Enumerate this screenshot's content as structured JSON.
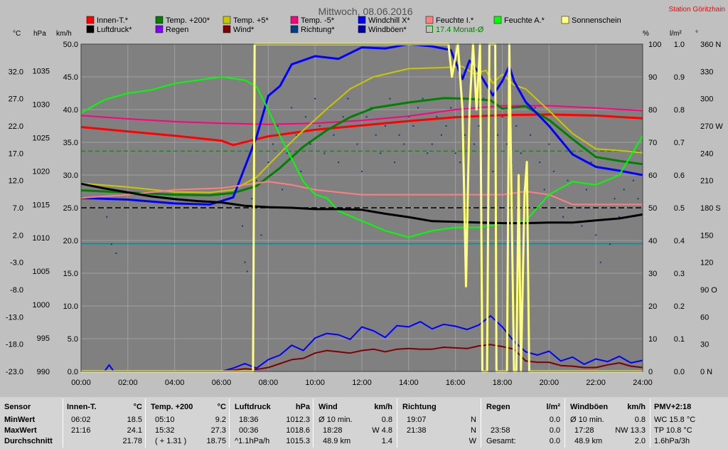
{
  "chart_data": {
    "type": "line",
    "title": "Mittwoch, 08.06.2016",
    "station": "Station Göritzhain",
    "x_ticks": [
      "00:00",
      "02:00",
      "04:00",
      "06:00",
      "08:00",
      "10:00",
      "12:00",
      "14:00",
      "16:00",
      "18:00",
      "20:00",
      "22:00",
      "24:00"
    ],
    "axes": {
      "temp": {
        "unit": "°C",
        "ticks": [
          "32.0",
          "27.0",
          "22.0",
          "17.0",
          "12.0",
          "7.0",
          "2.0",
          "-3.0",
          "-8.0",
          "-13.0",
          "-18.0",
          "-23.0"
        ],
        "range": [
          -23,
          37
        ]
      },
      "pressure": {
        "unit": "hPa",
        "ticks": [
          "1035",
          "1030",
          "1025",
          "1020",
          "1015",
          "1010",
          "1005",
          "1000",
          "995",
          "990"
        ],
        "range": [
          990,
          1039
        ]
      },
      "wind": {
        "unit": "km/h",
        "ticks": [
          "50.0",
          "45.0",
          "40.0",
          "35.0",
          "30.0",
          "25.0",
          "20.0",
          "15.0",
          "10.0",
          "5.0",
          "0.0"
        ],
        "range": [
          0,
          50
        ]
      },
      "humidity": {
        "unit": "%",
        "ticks": [
          "100",
          "90",
          "80",
          "70",
          "60",
          "50",
          "40",
          "30",
          "20",
          "10",
          "0"
        ],
        "range": [
          0,
          100
        ]
      },
      "rain": {
        "unit": "l/m²",
        "ticks": [
          "1.0",
          "0.9",
          "0.8",
          "0.7",
          "0.6",
          "0.5",
          "0.4",
          "0.3",
          "0.2",
          "0.1",
          "0.0"
        ],
        "range": [
          0,
          1
        ]
      },
      "direction": {
        "unit": "°",
        "ticks": [
          "360 N",
          "330",
          "300",
          "270 W",
          "240",
          "210",
          "180 S",
          "150",
          "120",
          "90 O",
          "60",
          "30",
          "0 N"
        ],
        "range": [
          0,
          360
        ]
      }
    },
    "legend": [
      {
        "name": "Innen-T.*",
        "color": "#ff0000"
      },
      {
        "name": "Temp. +200*",
        "color": "#008000"
      },
      {
        "name": "Temp. +5*",
        "color": "#c8c800"
      },
      {
        "name": "Temp. -5*",
        "color": "#ff0080"
      },
      {
        "name": "Windchill X*",
        "color": "#0000ff"
      },
      {
        "name": "Feuchte I.*",
        "color": "#ff8080"
      },
      {
        "name": "Feuchte A.*",
        "color": "#00ff00"
      },
      {
        "name": "Sonnenschein",
        "color": "#ffff80"
      },
      {
        "name": "Luftdruck*",
        "color": "#000000"
      },
      {
        "name": "Regen",
        "color": "#8000ff"
      },
      {
        "name": "Wind*",
        "color": "#800000"
      },
      {
        "name": "Richtung*",
        "color": "#004080"
      },
      {
        "name": "Windböen*",
        "color": "#0000a0"
      },
      {
        "name": "17.4 Monat-Ø",
        "color": "#008000",
        "hollow": true
      }
    ],
    "reference_lines": [
      {
        "axis": "temp",
        "value": 17.4,
        "color": "#008000",
        "style": "dash"
      },
      {
        "axis": "wind",
        "value": 25,
        "color": "#000000",
        "style": "dash"
      },
      {
        "axis": "humidity",
        "value": 39,
        "color": "#008080",
        "style": "solid"
      }
    ],
    "series": [
      {
        "name": "Innen-T.*",
        "axis": "temp",
        "color": "#ff0000",
        "width": 3,
        "x": [
          0,
          2,
          4,
          6,
          6.5,
          8,
          10,
          12,
          14,
          16,
          18,
          20,
          22,
          24
        ],
        "y": [
          21.8,
          21.0,
          20.2,
          19.3,
          18.5,
          20.1,
          21.3,
          22.1,
          22.9,
          23.6,
          24.0,
          24.1,
          23.9,
          23.4
        ]
      },
      {
        "name": "Temp. -5*",
        "axis": "temp",
        "color": "#ff0080",
        "width": 2,
        "x": [
          0,
          2,
          4,
          6,
          8,
          10,
          12,
          14,
          16,
          18,
          20,
          22,
          24
        ],
        "y": [
          23.9,
          23.3,
          22.8,
          22.5,
          22.3,
          22.5,
          23.0,
          23.8,
          25.0,
          25.7,
          25.7,
          25.3,
          24.8
        ]
      },
      {
        "name": "Temp. +5*",
        "axis": "temp",
        "color": "#c8c800",
        "width": 2,
        "x": [
          0,
          2,
          4,
          5.5,
          6.5,
          7.5,
          8.5,
          9.5,
          10.5,
          11.5,
          12.5,
          14,
          15.5,
          16.3,
          16.8,
          17.3,
          17.6,
          18,
          18.5,
          19,
          20,
          21,
          22,
          23,
          24
        ],
        "y": [
          11.5,
          10.8,
          9.9,
          9.8,
          10.3,
          12.6,
          17.0,
          21.2,
          25.1,
          28.8,
          31.0,
          32.5,
          32.7,
          32.9,
          31.5,
          32.2,
          29.8,
          31.5,
          29.5,
          28.8,
          24.8,
          20.6,
          17.8,
          17.5,
          17.1
        ]
      },
      {
        "name": "Temp. +200*",
        "axis": "temp",
        "color": "#008000",
        "width": 3,
        "x": [
          0,
          2,
          4,
          5.5,
          6.5,
          7.5,
          8.5,
          9.5,
          10.5,
          11.5,
          12.5,
          14,
          15.5,
          16.5,
          17.5,
          18,
          19,
          20,
          21,
          22,
          23,
          24
        ],
        "y": [
          10.2,
          9.8,
          9.4,
          9.3,
          9.7,
          11.0,
          14.3,
          18.2,
          21.2,
          23.6,
          25.3,
          26.3,
          27.1,
          27.0,
          26.7,
          25.2,
          25.6,
          23.1,
          19.6,
          16.3,
          15.6,
          15.0
        ]
      },
      {
        "name": "Windchill X*",
        "axis": "temp",
        "color": "#0000ff",
        "width": 3,
        "x": [
          0,
          2,
          4,
          5.5,
          6.5,
          7.5,
          8,
          8.5,
          9,
          10,
          11,
          12,
          13,
          14,
          15,
          15.8,
          16.3,
          16.6,
          17,
          17.6,
          18,
          18.3,
          18.5,
          19,
          20,
          21,
          22,
          23,
          24
        ],
        "y": [
          8.8,
          8.5,
          7.8,
          7.6,
          8.9,
          20.0,
          27.5,
          29.3,
          33.3,
          34.8,
          34.3,
          36.4,
          36.2,
          37.0,
          36.6,
          35.9,
          30.6,
          34.0,
          31.8,
          27.6,
          30.2,
          33.0,
          30.2,
          26.4,
          22.0,
          16.8,
          14.5,
          13.8,
          13.0
        ]
      },
      {
        "name": "Feuchte I.*",
        "axis": "humidity",
        "color": "#ff8080",
        "width": 2,
        "x": [
          0,
          2,
          4,
          6,
          7,
          8,
          9,
          10,
          12,
          14,
          16,
          18,
          19,
          20,
          21,
          22,
          24
        ],
        "y": [
          53,
          54,
          55.5,
          56,
          57,
          58,
          57,
          55.5,
          54,
          54,
          54,
          54,
          55,
          54,
          51,
          51,
          51
        ]
      },
      {
        "name": "Feuchte A.*",
        "axis": "humidity",
        "color": "#00ff00",
        "width": 2,
        "x": [
          0,
          1,
          2,
          3,
          4,
          5,
          6,
          7,
          7.5,
          8,
          8.5,
          9,
          9.5,
          10,
          10.5,
          11,
          12,
          13,
          14,
          15,
          16,
          17,
          18,
          19,
          19.5,
          20,
          21,
          22,
          23,
          24
        ],
        "y": [
          79,
          83,
          85,
          86,
          88,
          89,
          90,
          89,
          87,
          80,
          72,
          65,
          58,
          54,
          53,
          49,
          46,
          43,
          41,
          43,
          44,
          44,
          45,
          46,
          50,
          54,
          58,
          57,
          60,
          72
        ]
      },
      {
        "name": "Luftdruck*",
        "axis": "pressure",
        "color": "#000000",
        "width": 3,
        "x": [
          0,
          1,
          2,
          3,
          4,
          5,
          6,
          7,
          8,
          9,
          10,
          11,
          12,
          13,
          14,
          15,
          16,
          17,
          18,
          19,
          20,
          21,
          22,
          23,
          24
        ],
        "y": [
          1018.1,
          1017.4,
          1016.8,
          1016.2,
          1015.8,
          1015.5,
          1015.3,
          1014.8,
          1014.6,
          1014.5,
          1014.3,
          1014.3,
          1014.2,
          1013.6,
          1013.1,
          1012.5,
          1012.4,
          1012.3,
          1012.2,
          1012.2,
          1012.3,
          1012.3,
          1012.6,
          1012.9,
          1013.5
        ]
      },
      {
        "name": "Windböen*",
        "axis": "wind",
        "color": "#0000ff",
        "width": 2,
        "x": [
          0,
          1,
          1.2,
          1.4,
          2,
          3,
          4,
          5,
          6,
          6.5,
          7,
          7.5,
          8,
          8.5,
          9,
          9.5,
          10,
          10.5,
          11,
          11.5,
          12,
          12.5,
          13,
          13.5,
          14,
          14.5,
          15,
          15.5,
          16,
          16.5,
          17,
          17.5,
          18,
          18.5,
          19,
          19.5,
          20,
          20.5,
          21,
          21.5,
          22,
          22.5,
          23,
          23.5,
          24
        ],
        "y": [
          0,
          0,
          1.0,
          0,
          0,
          0,
          0,
          0,
          0,
          0.5,
          1.2,
          0.5,
          1.8,
          2.5,
          4.0,
          3.2,
          5.1,
          5.8,
          5.6,
          4.9,
          6.8,
          6.2,
          5.2,
          7.0,
          6.8,
          7.6,
          6.5,
          7.2,
          6.9,
          6.4,
          7.1,
          8.5,
          6.8,
          4.6,
          3.0,
          2.5,
          3.1,
          1.6,
          2.2,
          1.1,
          1.9,
          1.5,
          2.3,
          1.3,
          1.7
        ]
      },
      {
        "name": "Wind*",
        "axis": "wind",
        "color": "#800000",
        "width": 2,
        "x": [
          0,
          6,
          6.5,
          7,
          7.5,
          8,
          8.5,
          9,
          9.5,
          10,
          10.5,
          11,
          11.5,
          12,
          12.5,
          13,
          13.5,
          14,
          14.5,
          15,
          15.5,
          16,
          16.5,
          17,
          17.5,
          18,
          18.5,
          19,
          19.5,
          20,
          20.5,
          21,
          21.5,
          22,
          22.5,
          23,
          23.5,
          24
        ],
        "y": [
          0,
          0,
          0.2,
          0.4,
          0.3,
          0.6,
          1.2,
          1.8,
          2.0,
          2.8,
          3.2,
          3.0,
          2.8,
          3.2,
          3.4,
          3.0,
          3.4,
          3.5,
          3.4,
          3.4,
          3.7,
          3.6,
          3.5,
          3.9,
          4.1,
          3.8,
          3.4,
          1.6,
          1.4,
          1.4,
          0.9,
          0.8,
          0.6,
          0.6,
          1.0,
          1.3,
          0.8,
          0.6
        ]
      },
      {
        "name": "Sonnenschein",
        "axis": "wind",
        "color": "#ffff80",
        "width": 3,
        "x": [
          0,
          7.35,
          7.42,
          15.7,
          15.85,
          16.1,
          16.3,
          16.45,
          16.6,
          16.75,
          16.9,
          17.05,
          17.15,
          17.35,
          17.45,
          17.5,
          17.7,
          17.75,
          18.2,
          18.3,
          18.5,
          18.6,
          18.7,
          18.8,
          18.95,
          19.05,
          19.15,
          19.25,
          19.35,
          19.5,
          24
        ],
        "y": [
          0,
          0,
          50,
          50,
          45,
          50,
          40,
          13,
          40,
          50,
          40,
          50,
          0,
          0,
          50,
          50,
          50,
          0,
          0,
          50,
          0,
          0,
          30,
          0,
          27,
          32,
          0,
          0,
          0,
          0,
          0
        ]
      },
      {
        "name": "Regen",
        "axis": "rain",
        "color": "#8000ff",
        "width": 1,
        "x": [
          0,
          24
        ],
        "y": [
          0,
          0
        ]
      }
    ],
    "direction_dots": {
      "axis": "direction",
      "color": "#004080",
      "x": [
        1.1,
        1.3,
        1.5,
        6.9,
        7.0,
        7.1,
        7.3,
        7.5,
        7.7,
        8.0,
        8.2,
        8.4,
        8.6,
        8.8,
        9.0,
        9.2,
        9.4,
        9.6,
        9.8,
        10.0,
        10.2,
        10.4,
        10.6,
        10.8,
        11.0,
        11.2,
        11.4,
        11.6,
        11.8,
        12.0,
        12.2,
        12.4,
        12.6,
        12.8,
        13.0,
        13.2,
        13.4,
        13.6,
        13.8,
        14.0,
        14.2,
        14.4,
        14.6,
        14.8,
        15.0,
        15.2,
        15.4,
        15.6,
        15.8,
        16.0,
        16.2,
        16.4,
        16.6,
        16.8,
        17.0,
        17.2,
        17.4,
        17.6,
        17.8,
        18.0,
        18.2,
        18.4,
        18.6,
        18.8,
        19.0,
        19.2,
        19.4,
        19.6,
        19.8,
        20.0,
        20.2,
        20.4,
        20.6,
        20.8,
        21.0,
        21.2,
        21.4,
        21.6,
        21.8,
        22.0,
        22.2,
        22.4,
        22.6,
        22.8,
        23.0,
        23.2,
        23.4,
        23.6,
        23.8
      ],
      "y": [
        170,
        140,
        130,
        160,
        120,
        110,
        190,
        210,
        150,
        230,
        250,
        270,
        200,
        240,
        290,
        260,
        220,
        280,
        250,
        300,
        270,
        240,
        290,
        260,
        230,
        280,
        300,
        270,
        250,
        220,
        280,
        290,
        260,
        240,
        270,
        300,
        230,
        260,
        250,
        280,
        270,
        290,
        300,
        240,
        250,
        280,
        260,
        270,
        290,
        240,
        230,
        260,
        280,
        250,
        270,
        300,
        240,
        220,
        260,
        280,
        250,
        230,
        270,
        240,
        210,
        260,
        290,
        230,
        200,
        250,
        220,
        190,
        170,
        210,
        240,
        180,
        160,
        200,
        230,
        150,
        120,
        180,
        140,
        190,
        170,
        200,
        180,
        210,
        190
      ]
    }
  },
  "stats": {
    "columns": [
      {
        "id": "sensor",
        "header": "Sensor",
        "unit": "",
        "rows": [
          "MinWert",
          "MaxWert",
          "Durchschnitt"
        ],
        "rowvals": [
          [
            "",
            ""
          ],
          [
            "",
            ""
          ],
          [
            "",
            ""
          ]
        ]
      },
      {
        "id": "innen",
        "header": "Innen-T.",
        "unit": "°C",
        "rowvals": [
          [
            "06:02",
            "18.5"
          ],
          [
            "21:16",
            "24.1"
          ],
          [
            "",
            "21.78"
          ]
        ]
      },
      {
        "id": "temp200",
        "header": "Temp. +200",
        "unit": "°C",
        "rowvals": [
          [
            "05:10",
            "9.2"
          ],
          [
            "15:32",
            "27.3"
          ],
          [
            "( + 1.31 )",
            "18.75"
          ]
        ]
      },
      {
        "id": "luftdruck",
        "header": "Luftdruck",
        "unit": "hPa",
        "rowvals": [
          [
            "18:36",
            "1012.3"
          ],
          [
            "00:36",
            "1018.6"
          ],
          [
            "^1.1hPa/h",
            "1015.3"
          ]
        ]
      },
      {
        "id": "wind",
        "header": "Wind",
        "unit": "km/h",
        "rowvals": [
          [
            "Ø 10 min.",
            "0.8"
          ],
          [
            "18:28",
            "W 4.8"
          ],
          [
            "48.9 km",
            "1.4"
          ]
        ]
      },
      {
        "id": "richtung",
        "header": "Richtung",
        "unit": "",
        "rowvals": [
          [
            "19:07",
            "N"
          ],
          [
            "21:38",
            "N"
          ],
          [
            "",
            "W"
          ]
        ]
      },
      {
        "id": "regen",
        "header": "Regen",
        "unit": "l/m²",
        "rowvals": [
          [
            "",
            "0.0"
          ],
          [
            "23:58",
            "0.0"
          ],
          [
            "Gesamt:",
            "0.0"
          ]
        ]
      },
      {
        "id": "windboeen",
        "header": "Windböen",
        "unit": "km/h",
        "rowvals": [
          [
            "Ø 10 min.",
            "0.8"
          ],
          [
            "17:28",
            "NW 13.3"
          ],
          [
            "48.9 km",
            "2.0"
          ]
        ]
      },
      {
        "id": "pmv",
        "header": "PMV+2:18",
        "unit": "",
        "rowvals": [
          [
            "WC 15.8 °C",
            ""
          ],
          [
            "TP 10.8 °C",
            ""
          ],
          [
            "1.6hPa/3h",
            ""
          ]
        ]
      }
    ]
  }
}
